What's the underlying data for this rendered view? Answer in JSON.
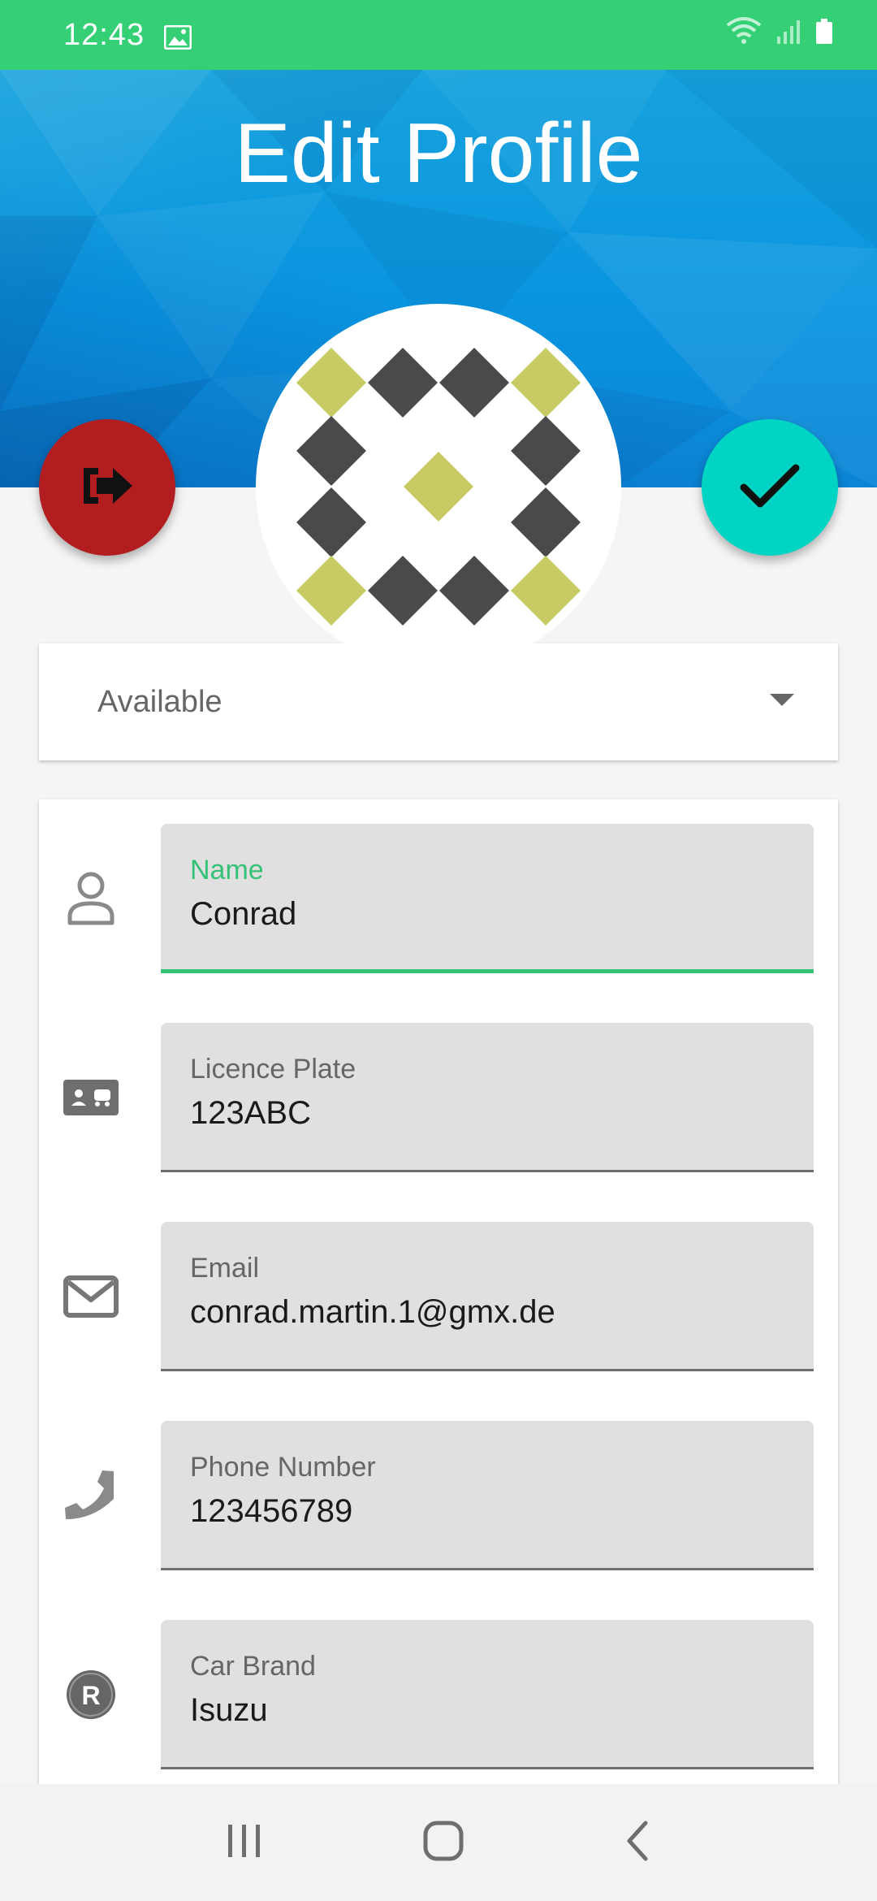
{
  "status_bar": {
    "time": "12:43",
    "icons": [
      "gallery-icon",
      "wifi-icon",
      "signal-icon",
      "battery-icon"
    ]
  },
  "header": {
    "title": "Edit Profile"
  },
  "actions": {
    "logout_icon": "logout-icon",
    "save_icon": "check-icon"
  },
  "availability": {
    "selected": "Available"
  },
  "fields": [
    {
      "label": "Name",
      "value": "Conrad",
      "icon": "person-icon",
      "focused": true
    },
    {
      "label": "Licence Plate",
      "value": "123ABC",
      "icon": "id-card-icon"
    },
    {
      "label": "Email",
      "value": "conrad.martin.1@gmx.de",
      "icon": "mail-icon"
    },
    {
      "label": "Phone Number",
      "value": "123456789",
      "icon": "phone-icon"
    },
    {
      "label": "Car Brand",
      "value": "Isuzu",
      "icon": "registered-icon"
    }
  ],
  "nav": {
    "icons": [
      "recent-apps-icon",
      "home-icon",
      "back-icon"
    ]
  },
  "colors": {
    "status_bar": "#35d076",
    "accent_green": "#35c277",
    "logout_red": "#b21d1f",
    "save_teal": "#00d5c4",
    "header_blue": "#0a95e0"
  }
}
